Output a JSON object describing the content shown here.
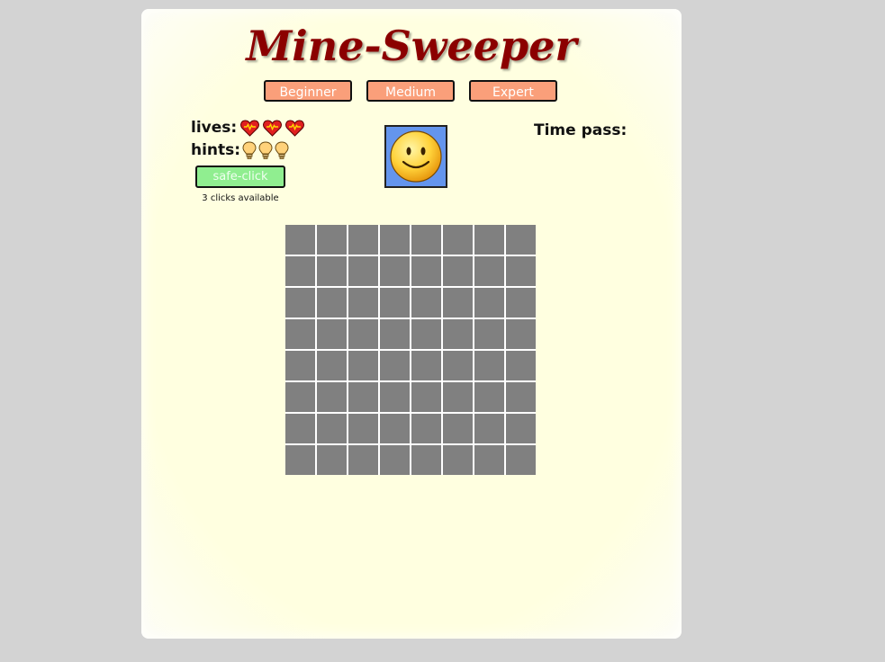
{
  "title": "Mine-Sweeper",
  "levels": [
    {
      "label": "Beginner"
    },
    {
      "label": "Medium"
    },
    {
      "label": "Expert"
    }
  ],
  "lives": {
    "label": "lives:",
    "count": 3,
    "icon": "heart-icon"
  },
  "hints": {
    "label": "hints:",
    "count": 3,
    "icon": "lightbulb-icon"
  },
  "safe_click": {
    "label": "safe-click",
    "note": "3 clicks available"
  },
  "face": {
    "icon": "smiley-face-icon",
    "state": "normal"
  },
  "timer": {
    "label": "Time pass:",
    "value": ""
  },
  "board": {
    "rows": 8,
    "cols": 8,
    "cell_state": "hidden"
  },
  "colors": {
    "page_bg": "#d3d3d3",
    "panel_bg": "#ffffe0",
    "title": "#8b0000",
    "level_button": "#fa9f7a",
    "safe_click_button": "#90ee90",
    "face_bg": "#6495ed",
    "hidden_cell": "#808080"
  }
}
